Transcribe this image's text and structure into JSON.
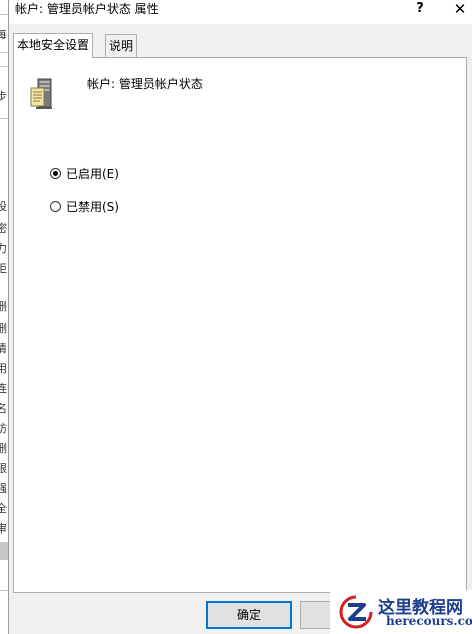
{
  "background_window": {
    "fragments": [
      "每",
      "步",
      "设",
      "密",
      "力",
      "拒",
      "删",
      "删",
      "清",
      "用",
      "连",
      "名",
      "访",
      "删",
      "限",
      "强",
      "全",
      "审"
    ]
  },
  "dialog": {
    "title": "帐户: 管理员帐户状态 属性",
    "help_glyph": "?",
    "close_glyph": "✕",
    "tabs": [
      {
        "label": "本地安全设置",
        "active": true
      },
      {
        "label": "说明",
        "active": false
      }
    ],
    "policy": {
      "icon": "server-icon",
      "label": "帐户: 管理员帐户状态"
    },
    "options": [
      {
        "label": "已启用(E)",
        "checked": true
      },
      {
        "label": "已禁用(S)",
        "checked": false
      }
    ],
    "buttons": {
      "ok": "确定",
      "cancel": ""
    }
  },
  "watermark": {
    "title": "这里教程网",
    "url": "herecours.com",
    "colors": {
      "primary": "#1d3d8f",
      "accent": "#d42020"
    }
  },
  "colors": {
    "accent": "#0078d7",
    "dialog_bg": "#f0f0f0",
    "panel_bg": "#ffffff"
  }
}
